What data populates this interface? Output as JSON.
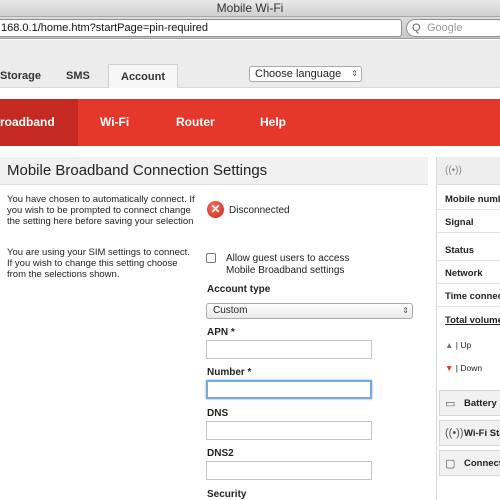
{
  "window": {
    "title": "Mobile Wi-Fi"
  },
  "browser": {
    "url": "168.0.1/home.htm?startPage=pin-required",
    "search_placeholder": "Google",
    "search_icon_glyph": "Q"
  },
  "topnav": {
    "storage": "Storage",
    "sms": "SMS",
    "account": "Account",
    "language_select": "Choose language",
    "arrow_glyph": "⇕"
  },
  "menu": {
    "broadband": "roadband",
    "wifi": "Wi-Fi",
    "router": "Router",
    "help": "Help"
  },
  "main": {
    "title": "Mobile Broadband Connection Settings",
    "auto_connect_text": "You have chosen to automatically connect. If you wish to be prompted to connect change the setting here before saving your selection",
    "sim_text": "You are using your SIM settings to connect. If you wish to change this setting choose from the selections shown.",
    "status_glyph": "✕",
    "status": "Disconnected",
    "guest_access_label": "Allow guest users to access Mobile Broadband settings",
    "account_type_label": "Account type",
    "account_type_value": "Custom",
    "apn_label": "APN *",
    "number_label": "Number *",
    "dns_label": "DNS",
    "dns2_label": "DNS2",
    "security_label": "Security"
  },
  "sidebar": {
    "signal_icon_glyph": "((•))",
    "mobile_number": "Mobile numb",
    "signal": "Signal",
    "status": "Status",
    "network": "Network",
    "time_connected": "Time connec",
    "total_volume": "Total volume",
    "up_glyph": "▲",
    "up": "| Up",
    "down_glyph": "▼",
    "down": "| Down",
    "battery": "Battery",
    "battery_icon_glyph": "▭",
    "wifi_status": "Wi-Fi Sta",
    "wifi_icon_glyph": "((•))",
    "connected": "Connect",
    "connected_icon_glyph": "▢"
  },
  "colors": {
    "menu_red": "#e6372d",
    "menu_active": "#c52a22",
    "status_error": "#c8261c",
    "down_arrow": "#d9382c"
  }
}
